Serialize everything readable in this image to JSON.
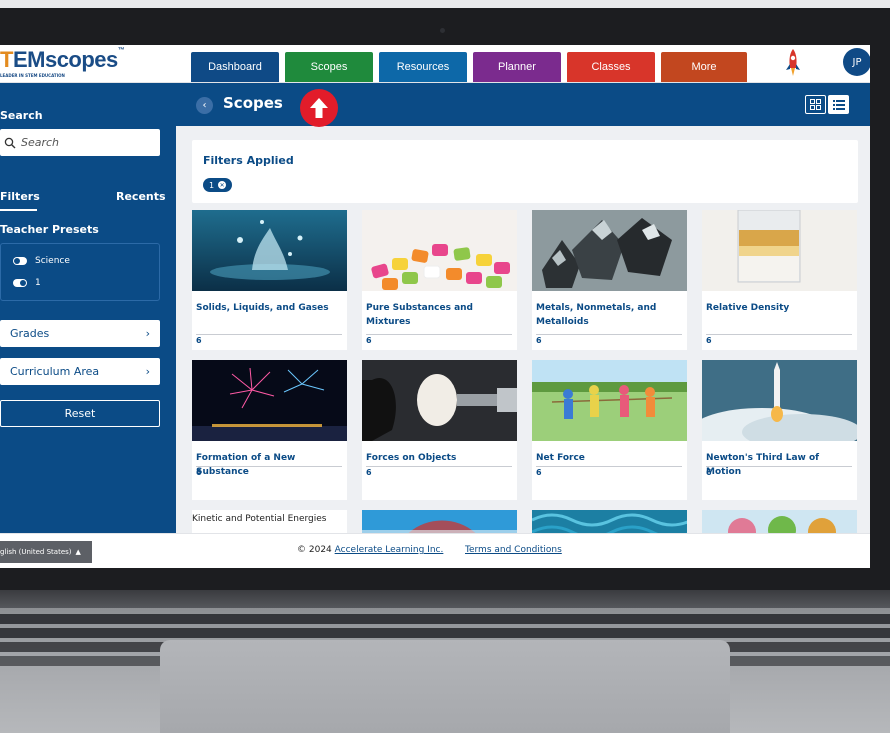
{
  "app": {
    "logo_lead": "T",
    "logo_main": "EMscopes",
    "logo_tm": "™",
    "logo_sub": "LEADER IN STEM EDUCATION"
  },
  "nav": {
    "tabs": [
      {
        "label": "Dashboard",
        "color": "#0f4a86"
      },
      {
        "label": "Scopes",
        "color": "#1f8a3c"
      },
      {
        "label": "Resources",
        "color": "#0d68a8"
      },
      {
        "label": "Planner",
        "color": "#7b2b8e"
      },
      {
        "label": "Classes",
        "color": "#d8352a"
      },
      {
        "label": "More",
        "color": "#c2471f"
      }
    ],
    "avatar_initials": "JP"
  },
  "sidebar": {
    "search_label": "Search",
    "search_placeholder": "Search",
    "tab_filters": "Filters",
    "tab_recents": "Recents",
    "presets_title": "Teacher Presets",
    "presets": [
      {
        "label": "Science",
        "state": "off"
      },
      {
        "label": "1",
        "state": "on"
      }
    ],
    "grades_label": "Grades",
    "curriculum_label": "Curriculum Area",
    "reset_label": "Reset"
  },
  "main": {
    "title": "Scopes",
    "filters_title": "Filters Applied",
    "filter_chip": "1",
    "cards": [
      {
        "title": "Solids, Liquids, and Gases",
        "grade": "6",
        "image": "water-splash"
      },
      {
        "title": "Pure Substances and Mixtures",
        "grade": "6",
        "image": "candies"
      },
      {
        "title": "Metals, Nonmetals, and Metalloids",
        "grade": "6",
        "image": "metal-crystals"
      },
      {
        "title": "Relative Density",
        "grade": "6",
        "image": "liquid-layers"
      },
      {
        "title": "Formation of a New Substance",
        "grade": "6",
        "image": "fireworks"
      },
      {
        "title": "Forces on Objects",
        "grade": "6",
        "image": "egg-in-vise"
      },
      {
        "title": "Net Force",
        "grade": "6",
        "image": "tug-of-war"
      },
      {
        "title": "Newton's Third Law of Motion",
        "grade": "6",
        "image": "rocket-launch"
      }
    ],
    "row3": [
      {
        "title": "Kinetic and Potential Energies"
      }
    ]
  },
  "footer": {
    "language": "glish (United States)",
    "copyright_prefix": "© 2024",
    "company_link": "Accelerate Learning Inc.",
    "terms_link": "Terms and Conditions"
  },
  "colors": {
    "brand_blue": "#0b4b86",
    "accent_red": "#e21c2a"
  }
}
